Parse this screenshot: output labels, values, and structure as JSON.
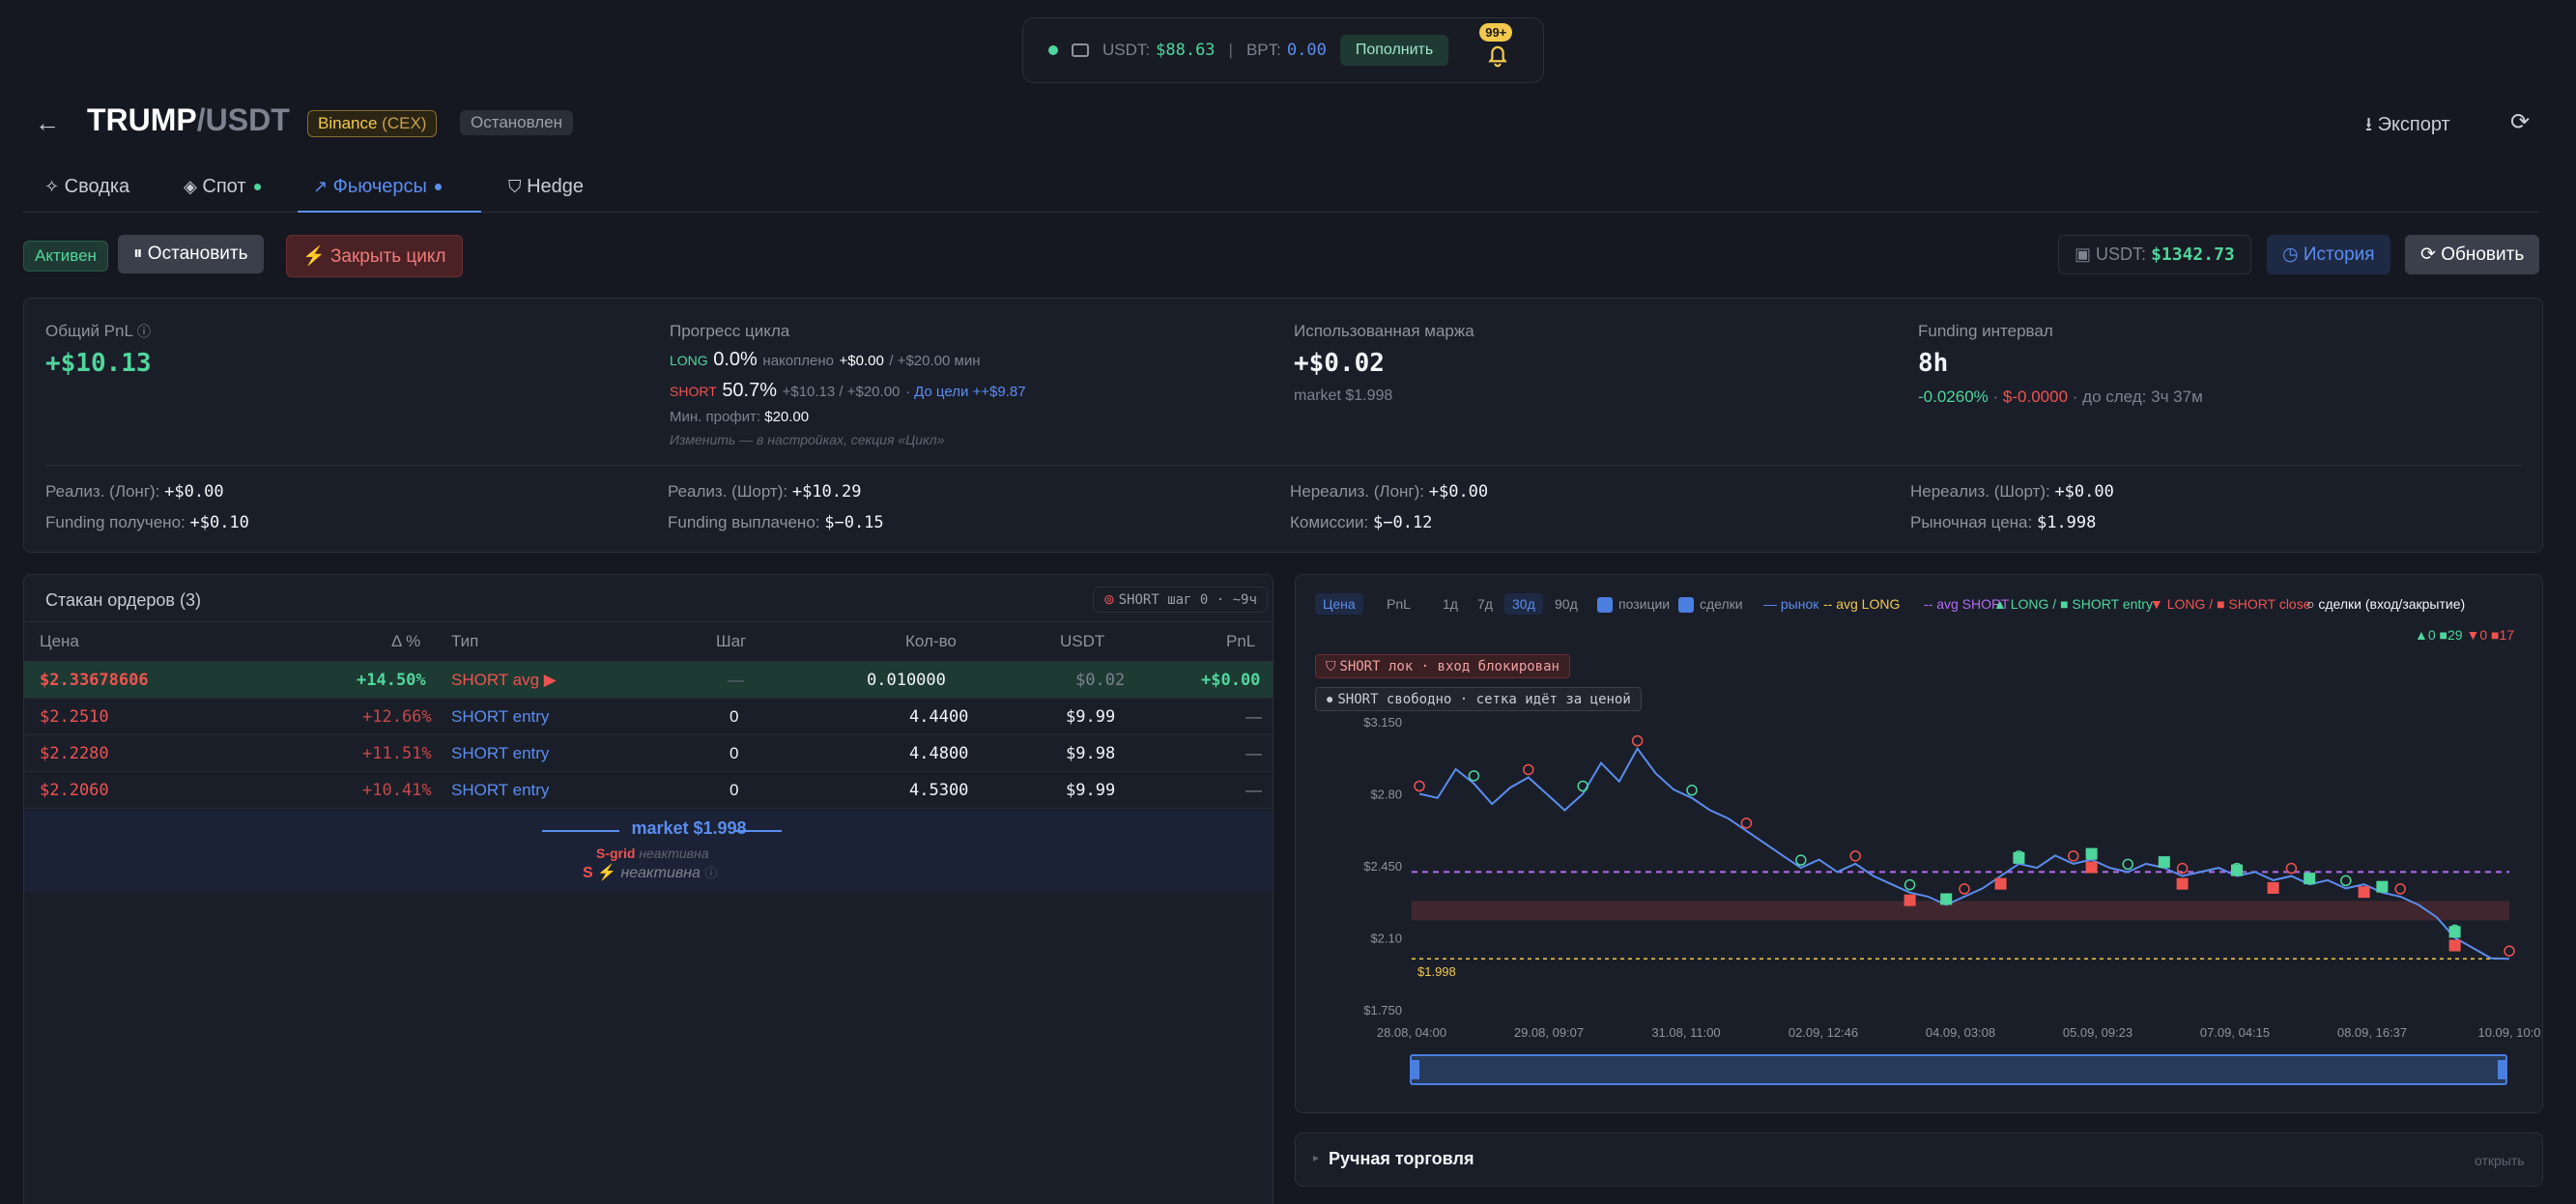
{
  "topbar": {
    "usdt_label": "USDT:",
    "usdt_value": "$88.63",
    "sep": "|",
    "bpt_label": "BPT:",
    "bpt_value": "0.00",
    "deposit": "Пополнить",
    "notif_count": "99+"
  },
  "header": {
    "pair_base": "TRUMP",
    "pair_sep": "/",
    "pair_quote": "USDT",
    "exchange": "Binance",
    "exchange_sub": "(CEX)",
    "status": "Остановлен",
    "export": "Экспорт"
  },
  "tabs": [
    {
      "label": "Сводка"
    },
    {
      "label": "Спот"
    },
    {
      "label": "Фьючерсы"
    },
    {
      "label": "Hedge"
    }
  ],
  "controls": {
    "active": "Активен",
    "stop": "Остановить",
    "close_cycle": "Закрыть цикл",
    "usdt_label": "USDT:",
    "usdt_value": "$1342.73",
    "history": "История",
    "update": "Обновить"
  },
  "stats": {
    "total_pnl_label": "Общий PnL",
    "total_pnl": "+$10.13",
    "progress_label": "Прогресс цикла",
    "long_tag": "LONG",
    "long_pct": "0.0%",
    "long_acc_label": "накоплено",
    "long_acc": "+$0.00",
    "long_min": "/ +$20.00 мин",
    "short_tag": "SHORT",
    "short_pct": "50.7%",
    "short_detail": "+$10.13 / +$20.00",
    "short_goal": "· До цели ++$9.87",
    "min_profit_label": "Мин. профит:",
    "min_profit": "$20.00",
    "hint": "Изменить — в настройках, секция «Цикл»",
    "margin_label": "Использованная маржа",
    "margin": "+$0.02",
    "margin_sub": "market $1.998",
    "funding_label": "Funding интервал",
    "funding": "8h",
    "funding_rate": "-0.0260%",
    "funding_sep1": "·",
    "funding_amt": "$-0.0000",
    "funding_next": "· до след: 3ч 37м",
    "real_long_label": "Реализ. (Лонг):",
    "real_long": "+$0.00",
    "real_short_label": "Реализ. (Шорт):",
    "real_short": "+$10.29",
    "unreal_long_label": "Нереализ. (Лонг):",
    "unreal_long": "+$0.00",
    "unreal_short_label": "Нереализ. (Шорт):",
    "unreal_short": "+$0.00",
    "fund_recv_label": "Funding получено:",
    "fund_recv": "+$0.10",
    "fund_paid_label": "Funding выплачено:",
    "fund_paid": "$−0.15",
    "fees_label": "Комиссии:",
    "fees": "$−0.12",
    "mkt_label": "Рыночная цена:",
    "mkt": "$1.998"
  },
  "orderbook": {
    "title": "Стакан ордеров (3)",
    "pill": "SHORT шаг 0 · ~9ч",
    "headers": [
      "Цена",
      "Δ %",
      "Тип",
      "Шаг",
      "Кол-во",
      "USDT",
      "PnL"
    ],
    "rows": [
      {
        "price": "$2.33678606",
        "delta": "+14.50%",
        "type": "SHORT avg ▶",
        "step": "—",
        "qty": "0.010000",
        "usdt": "$0.02",
        "pnl": "+$0.00"
      },
      {
        "price": "$2.2510",
        "delta": "+12.66%",
        "type": "SHORT entry",
        "step": "0",
        "qty": "4.4400",
        "usdt": "$9.99",
        "pnl": "—"
      },
      {
        "price": "$2.2280",
        "delta": "+11.51%",
        "type": "SHORT entry",
        "step": "0",
        "qty": "4.4800",
        "usdt": "$9.98",
        "pnl": "—"
      },
      {
        "price": "$2.2060",
        "delta": "+10.41%",
        "type": "SHORT entry",
        "step": "0",
        "qty": "4.5300",
        "usdt": "$9.99",
        "pnl": "—"
      }
    ],
    "market_line": "market $1.998",
    "sgrid_label": "S-grid",
    "sgrid_state": "неактивна",
    "s_label": "S",
    "s_state": "неактивна"
  },
  "chart": {
    "modes": [
      "Цена",
      "PnL"
    ],
    "ranges": [
      "1д",
      "7д",
      "30д",
      "90д"
    ],
    "selected_range": "30д",
    "chk_positions": "позиции",
    "chk_trades": "сделки",
    "legend": {
      "market": "— рынок",
      "avg_long": "-- avg LONG",
      "avg_short": "-- avg SHORT",
      "entry": "▲ LONG / ■ SHORT entry",
      "close": "▼ LONG / ■ SHORT close",
      "trades": "○ сделки (вход/закрытие)"
    },
    "counts": {
      "a": "▲0",
      "b": "■29",
      "c": "▼0",
      "d": "■17"
    },
    "lock_banner": "SHORT лок · вход блокирован",
    "free_banner": "SHORT свободно · сетка идёт за ценой",
    "price_label": "$1.998"
  },
  "chart_data": {
    "type": "line",
    "title": "",
    "y_ticks": [
      "$3.150",
      "$2.80",
      "$2.450",
      "$2.10",
      "$1.750"
    ],
    "ylim": [
      1.75,
      3.15
    ],
    "x_ticks": [
      "28.08, 04:00",
      "29.08, 09:07",
      "31.08, 11:00",
      "02.09, 12:46",
      "04.09, 03:08",
      "05.09, 09:23",
      "07.09, 04:15",
      "08.09, 16:37",
      "10.09, 10:0"
    ],
    "series": [
      {
        "values": [
          2.8,
          2.78,
          2.92,
          2.85,
          2.75,
          2.83,
          2.88,
          2.8,
          2.72,
          2.8,
          2.95,
          2.86,
          3.02,
          2.9,
          2.82,
          2.78,
          2.72,
          2.68,
          2.62,
          2.56,
          2.5,
          2.44,
          2.48,
          2.42,
          2.46,
          2.4,
          2.36,
          2.32,
          2.3,
          2.26,
          2.3,
          2.34,
          2.4,
          2.46,
          2.44,
          2.5,
          2.46,
          2.48,
          2.44,
          2.42,
          2.46,
          2.44,
          2.4,
          2.42,
          2.44,
          2.4,
          2.42,
          2.38,
          2.4,
          2.36,
          2.38,
          2.34,
          2.36,
          2.32,
          2.3,
          2.26,
          2.2,
          2.1,
          2.05,
          2.0,
          1.998
        ]
      }
    ],
    "avg_short": 2.42,
    "market": 1.998
  },
  "manual": {
    "title": "Ручная торговля",
    "open": "открыть"
  }
}
